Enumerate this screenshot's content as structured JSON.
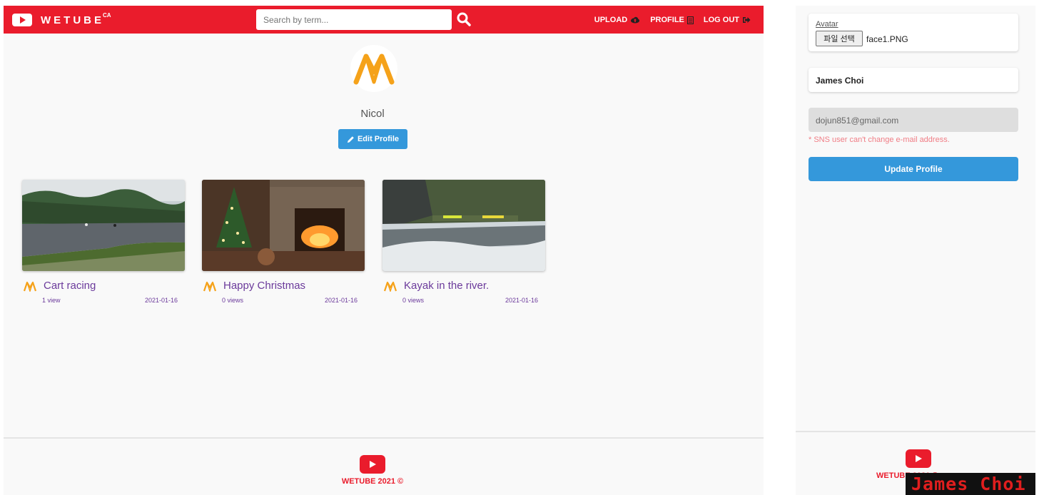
{
  "header": {
    "brand": "WETUBE",
    "brand_sup": "CA",
    "search_placeholder": "Search by term...",
    "nav": [
      {
        "label": "UPLOAD",
        "icon": "cloud-upload-icon"
      },
      {
        "label": "PROFILE",
        "icon": "id-card-icon"
      },
      {
        "label": "LOG OUT",
        "icon": "sign-out-icon"
      }
    ]
  },
  "profile": {
    "name": "Nicol",
    "edit_label": "Edit Profile"
  },
  "videos": [
    {
      "title": "Cart racing",
      "views": "1 view",
      "date": "2021-01-16"
    },
    {
      "title": "Happy Christmas",
      "views": "0 views",
      "date": "2021-01-16"
    },
    {
      "title": "Kayak in the river.",
      "views": "0 views",
      "date": "2021-01-16"
    }
  ],
  "footer": {
    "text": "WETUBE 2021 ©"
  },
  "edit_form": {
    "avatar_label": "Avatar",
    "file_button": "파일 선택",
    "file_name": "face1.PNG",
    "name_value": "James Choi",
    "email_value": "dojun851@gmail.com",
    "email_note": "* SNS user can't change e-mail address.",
    "update_label": "Update Profile",
    "footer_text": "WETUBE 2021 ©",
    "overlay_text": "James Choi"
  },
  "colors": {
    "brand_red": "#ea1c2c",
    "button_blue": "#3498db",
    "video_title": "#6b3a9b",
    "logo_orange": "#f5a21a"
  }
}
